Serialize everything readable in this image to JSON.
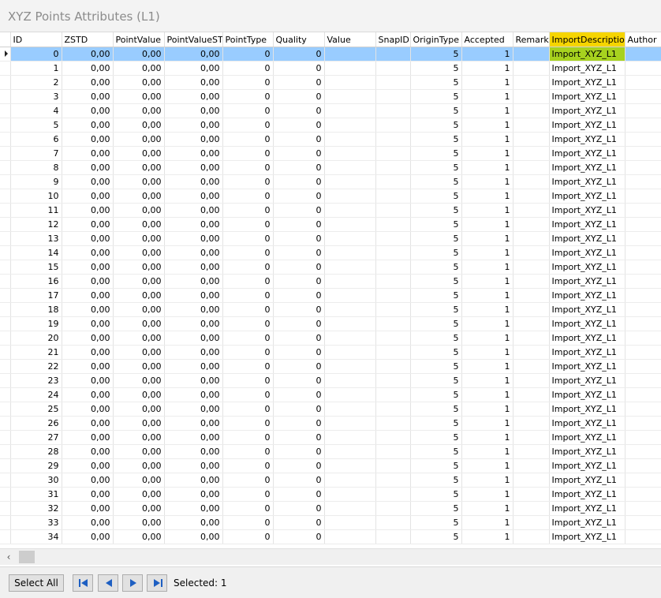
{
  "window": {
    "title": "XYZ Points Attributes (L1)"
  },
  "grid": {
    "columns": [
      "ID",
      "ZSTD",
      "PointValue",
      "PointValueSTD",
      "PointType",
      "Quality",
      "Value",
      "SnapID",
      "OriginType",
      "Accepted",
      "Remark",
      "ImportDescription",
      "Author"
    ],
    "highlighted_column": "ImportDescription",
    "selected_row_index": 0,
    "rows": [
      [
        "0",
        "0,00",
        "0,00",
        "0,00",
        "0",
        "0",
        "",
        "",
        "5",
        "1",
        "",
        "Import_XYZ_L1",
        ""
      ],
      [
        "1",
        "0,00",
        "0,00",
        "0,00",
        "0",
        "0",
        "",
        "",
        "5",
        "1",
        "",
        "Import_XYZ_L1",
        ""
      ],
      [
        "2",
        "0,00",
        "0,00",
        "0,00",
        "0",
        "0",
        "",
        "",
        "5",
        "1",
        "",
        "Import_XYZ_L1",
        ""
      ],
      [
        "3",
        "0,00",
        "0,00",
        "0,00",
        "0",
        "0",
        "",
        "",
        "5",
        "1",
        "",
        "Import_XYZ_L1",
        ""
      ],
      [
        "4",
        "0,00",
        "0,00",
        "0,00",
        "0",
        "0",
        "",
        "",
        "5",
        "1",
        "",
        "Import_XYZ_L1",
        ""
      ],
      [
        "5",
        "0,00",
        "0,00",
        "0,00",
        "0",
        "0",
        "",
        "",
        "5",
        "1",
        "",
        "Import_XYZ_L1",
        ""
      ],
      [
        "6",
        "0,00",
        "0,00",
        "0,00",
        "0",
        "0",
        "",
        "",
        "5",
        "1",
        "",
        "Import_XYZ_L1",
        ""
      ],
      [
        "7",
        "0,00",
        "0,00",
        "0,00",
        "0",
        "0",
        "",
        "",
        "5",
        "1",
        "",
        "Import_XYZ_L1",
        ""
      ],
      [
        "8",
        "0,00",
        "0,00",
        "0,00",
        "0",
        "0",
        "",
        "",
        "5",
        "1",
        "",
        "Import_XYZ_L1",
        ""
      ],
      [
        "9",
        "0,00",
        "0,00",
        "0,00",
        "0",
        "0",
        "",
        "",
        "5",
        "1",
        "",
        "Import_XYZ_L1",
        ""
      ],
      [
        "10",
        "0,00",
        "0,00",
        "0,00",
        "0",
        "0",
        "",
        "",
        "5",
        "1",
        "",
        "Import_XYZ_L1",
        ""
      ],
      [
        "11",
        "0,00",
        "0,00",
        "0,00",
        "0",
        "0",
        "",
        "",
        "5",
        "1",
        "",
        "Import_XYZ_L1",
        ""
      ],
      [
        "12",
        "0,00",
        "0,00",
        "0,00",
        "0",
        "0",
        "",
        "",
        "5",
        "1",
        "",
        "Import_XYZ_L1",
        ""
      ],
      [
        "13",
        "0,00",
        "0,00",
        "0,00",
        "0",
        "0",
        "",
        "",
        "5",
        "1",
        "",
        "Import_XYZ_L1",
        ""
      ],
      [
        "14",
        "0,00",
        "0,00",
        "0,00",
        "0",
        "0",
        "",
        "",
        "5",
        "1",
        "",
        "Import_XYZ_L1",
        ""
      ],
      [
        "15",
        "0,00",
        "0,00",
        "0,00",
        "0",
        "0",
        "",
        "",
        "5",
        "1",
        "",
        "Import_XYZ_L1",
        ""
      ],
      [
        "16",
        "0,00",
        "0,00",
        "0,00",
        "0",
        "0",
        "",
        "",
        "5",
        "1",
        "",
        "Import_XYZ_L1",
        ""
      ],
      [
        "17",
        "0,00",
        "0,00",
        "0,00",
        "0",
        "0",
        "",
        "",
        "5",
        "1",
        "",
        "Import_XYZ_L1",
        ""
      ],
      [
        "18",
        "0,00",
        "0,00",
        "0,00",
        "0",
        "0",
        "",
        "",
        "5",
        "1",
        "",
        "Import_XYZ_L1",
        ""
      ],
      [
        "19",
        "0,00",
        "0,00",
        "0,00",
        "0",
        "0",
        "",
        "",
        "5",
        "1",
        "",
        "Import_XYZ_L1",
        ""
      ],
      [
        "20",
        "0,00",
        "0,00",
        "0,00",
        "0",
        "0",
        "",
        "",
        "5",
        "1",
        "",
        "Import_XYZ_L1",
        ""
      ],
      [
        "21",
        "0,00",
        "0,00",
        "0,00",
        "0",
        "0",
        "",
        "",
        "5",
        "1",
        "",
        "Import_XYZ_L1",
        ""
      ],
      [
        "22",
        "0,00",
        "0,00",
        "0,00",
        "0",
        "0",
        "",
        "",
        "5",
        "1",
        "",
        "Import_XYZ_L1",
        ""
      ],
      [
        "23",
        "0,00",
        "0,00",
        "0,00",
        "0",
        "0",
        "",
        "",
        "5",
        "1",
        "",
        "Import_XYZ_L1",
        ""
      ],
      [
        "24",
        "0,00",
        "0,00",
        "0,00",
        "0",
        "0",
        "",
        "",
        "5",
        "1",
        "",
        "Import_XYZ_L1",
        ""
      ],
      [
        "25",
        "0,00",
        "0,00",
        "0,00",
        "0",
        "0",
        "",
        "",
        "5",
        "1",
        "",
        "Import_XYZ_L1",
        ""
      ],
      [
        "26",
        "0,00",
        "0,00",
        "0,00",
        "0",
        "0",
        "",
        "",
        "5",
        "1",
        "",
        "Import_XYZ_L1",
        ""
      ],
      [
        "27",
        "0,00",
        "0,00",
        "0,00",
        "0",
        "0",
        "",
        "",
        "5",
        "1",
        "",
        "Import_XYZ_L1",
        ""
      ],
      [
        "28",
        "0,00",
        "0,00",
        "0,00",
        "0",
        "0",
        "",
        "",
        "5",
        "1",
        "",
        "Import_XYZ_L1",
        ""
      ],
      [
        "29",
        "0,00",
        "0,00",
        "0,00",
        "0",
        "0",
        "",
        "",
        "5",
        "1",
        "",
        "Import_XYZ_L1",
        ""
      ],
      [
        "30",
        "0,00",
        "0,00",
        "0,00",
        "0",
        "0",
        "",
        "",
        "5",
        "1",
        "",
        "Import_XYZ_L1",
        ""
      ],
      [
        "31",
        "0,00",
        "0,00",
        "0,00",
        "0",
        "0",
        "",
        "",
        "5",
        "1",
        "",
        "Import_XYZ_L1",
        ""
      ],
      [
        "32",
        "0,00",
        "0,00",
        "0,00",
        "0",
        "0",
        "",
        "",
        "5",
        "1",
        "",
        "Import_XYZ_L1",
        ""
      ],
      [
        "33",
        "0,00",
        "0,00",
        "0,00",
        "0",
        "0",
        "",
        "",
        "5",
        "1",
        "",
        "Import_XYZ_L1",
        ""
      ],
      [
        "34",
        "0,00",
        "0,00",
        "0,00",
        "0",
        "0",
        "",
        "",
        "5",
        "1",
        "",
        "Import_XYZ_L1",
        ""
      ]
    ]
  },
  "scrollbar": {
    "left_arrow_icon": "chevron-left-icon"
  },
  "toolbar": {
    "select_all_label": "Select All",
    "nav_icons": [
      "first-record-icon",
      "previous-record-icon",
      "next-record-icon",
      "last-record-icon"
    ],
    "selected_label": "Selected: 1"
  },
  "colors": {
    "selected_row": "#99ccff",
    "selected_import_cell": "#a7d21f",
    "highlighted_header": "#f6d500",
    "nav_icon": "#1e5fc2"
  }
}
